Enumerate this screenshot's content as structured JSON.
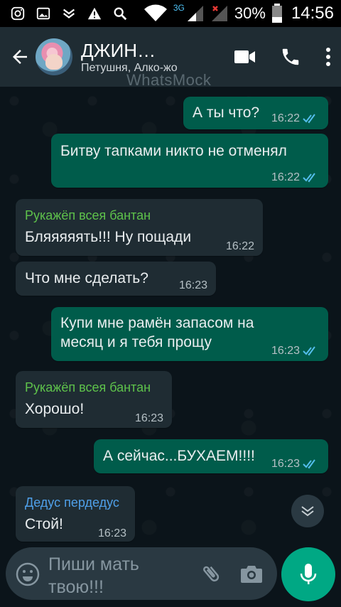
{
  "statusbar": {
    "battery_percent": "30%",
    "time": "14:56",
    "network_label": "3G",
    "icons": [
      "instagram-icon",
      "image-icon",
      "download-icon",
      "warning-icon",
      "search-icon",
      "wifi-icon",
      "signal-icon",
      "battery-icon"
    ]
  },
  "header": {
    "title": "ДЖИН…",
    "subtitle": "Петушня, Алко-жо",
    "watermark": "WhatsMock",
    "icons": [
      "back-arrow-icon",
      "video-call-icon",
      "phone-call-icon",
      "more-vert-icon"
    ]
  },
  "messages": [
    {
      "direction": "out",
      "text": "А ты что?",
      "time": "16:22",
      "status": "read"
    },
    {
      "direction": "out",
      "text": "Битву тапками никто не отменял",
      "time": "16:22",
      "status": "read"
    },
    {
      "direction": "in",
      "sender": "Рукажёп всея бантан",
      "text": "Бляяяяять!!! Ну пощади",
      "time": "16:22"
    },
    {
      "direction": "in",
      "text": "Что мне сделать?",
      "time": "16:23"
    },
    {
      "direction": "out",
      "text_lines": [
        "Купи мне рамён запасом на",
        "месяц и я тебя прощу"
      ],
      "time": "16:23",
      "status": "read"
    },
    {
      "direction": "in",
      "sender": "Рукажёп всея бантан",
      "text": "Хорошо!",
      "time": "16:23"
    },
    {
      "direction": "out",
      "text": "А сейчас...БУХАЕМ!!!!",
      "time": "16:23",
      "status": "read"
    },
    {
      "direction": "in",
      "sender": "Дедус пердедус",
      "text": "Стой!",
      "time": "16:23"
    }
  ],
  "colors": {
    "outgoing_bubble": "#005c4b",
    "incoming_bubble": "#1f2c33",
    "sender_green": "#5ec24b",
    "sender_blue": "#4f9fe8",
    "read_ticks": "#53bdeb",
    "mic_button": "#00a884"
  },
  "input": {
    "placeholder_lines": [
      "Пиши мать",
      "твою!!!"
    ]
  }
}
